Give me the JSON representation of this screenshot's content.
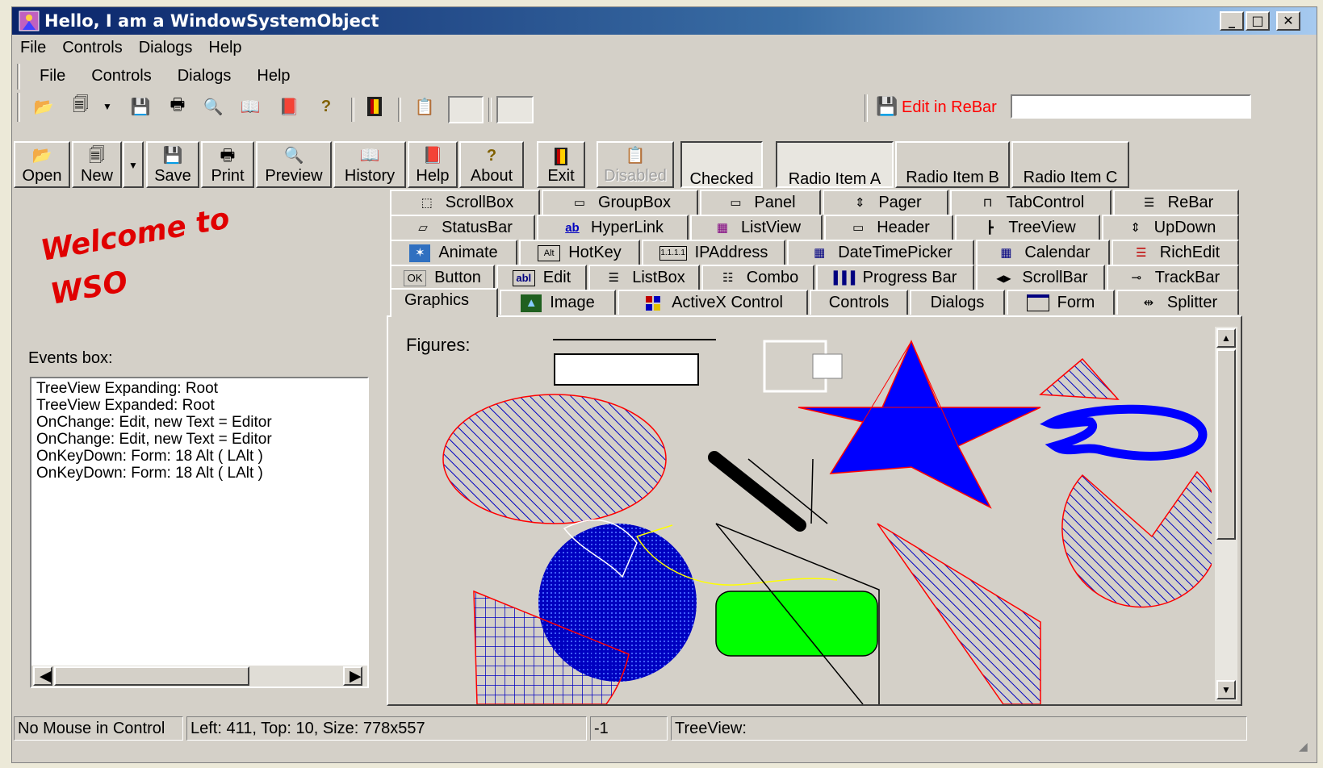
{
  "window": {
    "title": "Hello, I am a WindowSystemObject"
  },
  "menubar": [
    "File",
    "Controls",
    "Dialogs",
    "Help"
  ],
  "menubar2": [
    "File",
    "Controls",
    "Dialogs",
    "Help"
  ],
  "toolbar": {
    "icons": [
      "open-folder-icon",
      "new-document-icon",
      "dropdown-arrow-icon",
      "save-disk-icon",
      "print-icon",
      "preview-icon",
      "history-book-icon",
      "help-book-icon",
      "about-question-icon",
      "exit-door-icon",
      "disabled-paste-icon"
    ],
    "rebar_label": "Edit in ReBar",
    "rebar_value": ""
  },
  "buttons": [
    {
      "label": "Open",
      "icon": "open-folder-icon"
    },
    {
      "label": "New",
      "icon": "new-document-icon"
    },
    {
      "label": "Save",
      "icon": "save-disk-icon"
    },
    {
      "label": "Print",
      "icon": "print-icon"
    },
    {
      "label": "Preview",
      "icon": "preview-icon"
    },
    {
      "label": "History",
      "icon": "history-book-icon"
    },
    {
      "label": "Help",
      "icon": "help-book-icon"
    },
    {
      "label": "About",
      "icon": "about-question-icon"
    },
    {
      "label": "Exit",
      "icon": "exit-door-icon"
    },
    {
      "label": "Disabled",
      "icon": "disabled-paste-icon"
    },
    {
      "label": "Checked"
    },
    {
      "label": "Radio Item A"
    },
    {
      "label": "Radio Item B"
    },
    {
      "label": "Radio Item C"
    }
  ],
  "welcome": {
    "line1": "Welcome to",
    "line2": "WSO"
  },
  "events": {
    "label": "Events box:",
    "items": [
      "TreeView Expanding: Root",
      "TreeView Expanded: Root",
      "OnChange: Edit, new Text = Editor",
      "OnChange: Edit, new Text = Editor",
      "OnKeyDown: Form: 18 Alt ( LAlt )",
      "OnKeyDown: Form: 18 Alt ( LAlt )"
    ]
  },
  "tabs": {
    "row1": [
      "ScrollBox",
      "GroupBox",
      "Panel",
      "Pager",
      "TabControl",
      "ReBar"
    ],
    "row2": [
      "StatusBar",
      "HyperLink",
      "ListView",
      "Header",
      "TreeView",
      "UpDown"
    ],
    "row3": [
      "Animate",
      "HotKey",
      "IPAddress",
      "DateTimePicker",
      "Calendar",
      "RichEdit"
    ],
    "row4": [
      "Button",
      "Edit",
      "ListBox",
      "Combo",
      "Progress Bar",
      "ScrollBar",
      "TrackBar"
    ],
    "row5": [
      "Graphics",
      "Image",
      "ActiveX Control",
      "Controls",
      "Dialogs",
      "Form",
      "Splitter"
    ],
    "active": "Graphics"
  },
  "graphics": {
    "figures_label": "Figures:"
  },
  "statusbar": [
    "No Mouse in Control",
    "Left: 411, Top: 10, Size: 778x557",
    "-1",
    "TreeView:"
  ],
  "colors": {
    "star": "#0000ff",
    "outline": "#ff0000",
    "rect": "#00ff00",
    "welcome": "#e00000"
  }
}
